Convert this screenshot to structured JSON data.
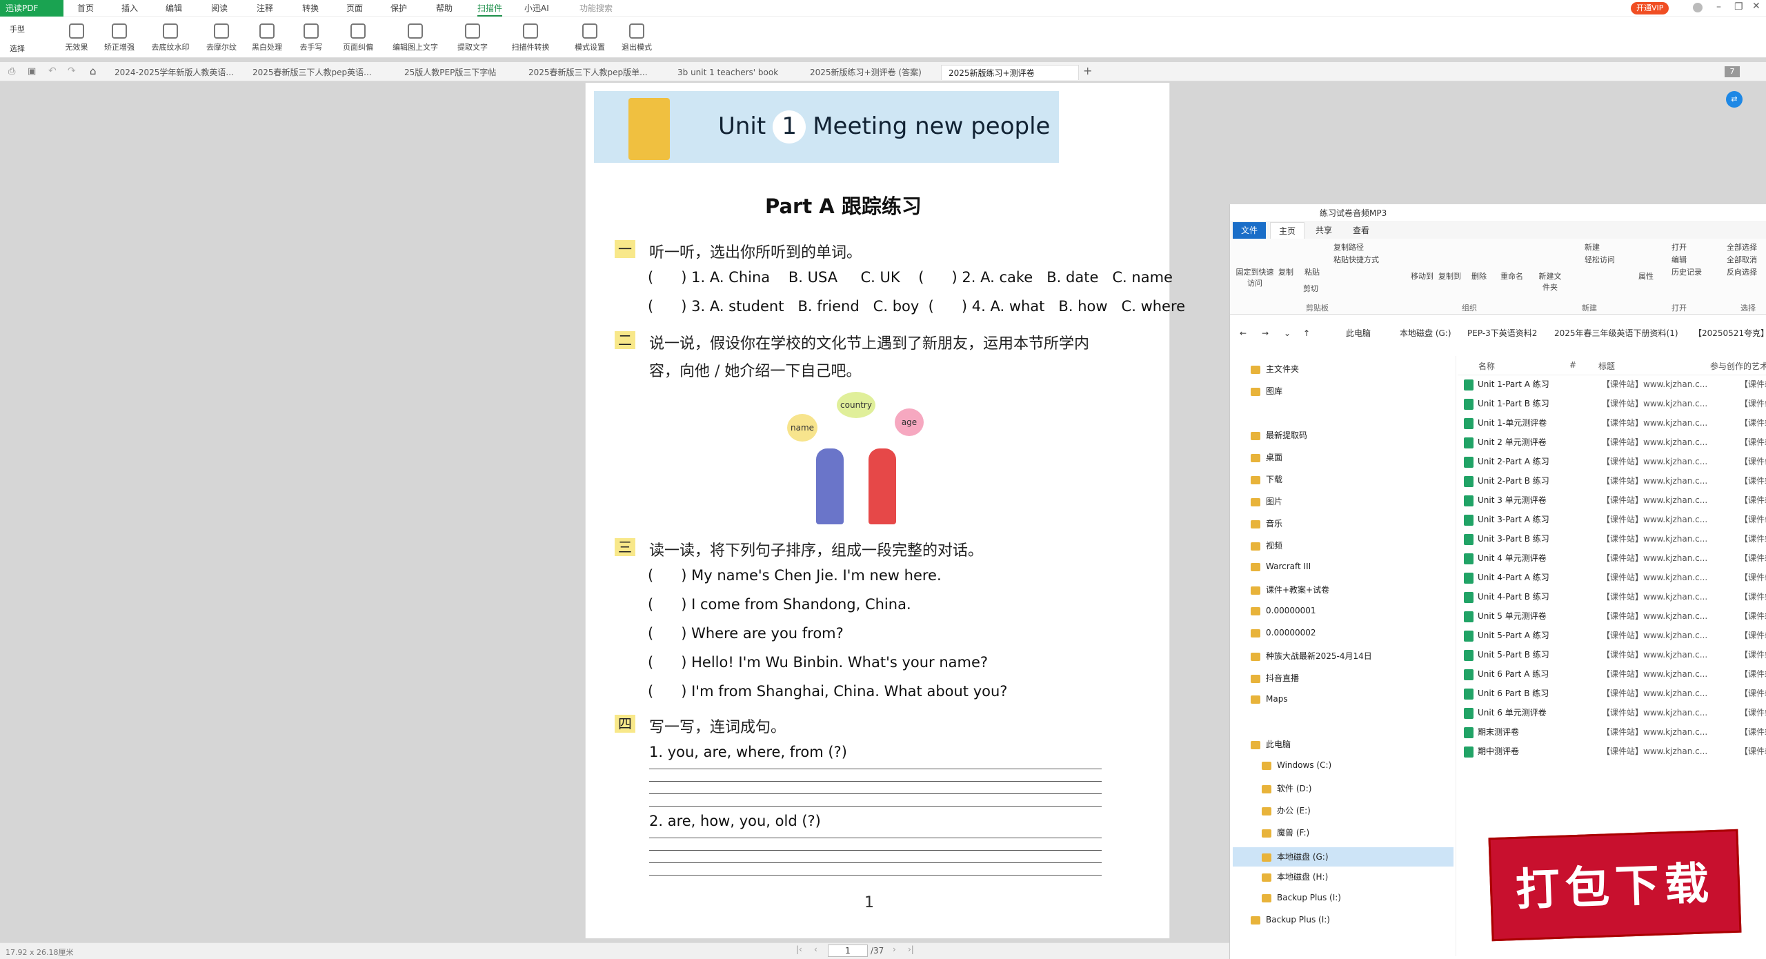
{
  "app": {
    "logo": "迅读PDF",
    "vip": "开通VIP",
    "menu": [
      "首页",
      "插入",
      "编辑",
      "阅读",
      "注释",
      "转换",
      "页面",
      "保护",
      "帮助",
      "扫描件",
      "小迅AI",
      "功能搜索"
    ],
    "active_menu": "扫描件",
    "left_tools": [
      "手型",
      "选择"
    ],
    "tools": [
      "无效果",
      "矫正增强",
      "去底纹水印",
      "去摩尔纹",
      "黑白处理",
      "去手写",
      "页面纠偏",
      "编辑图上文字",
      "提取文字",
      "扫描件转换",
      "模式设置",
      "退出模式"
    ],
    "tabs": [
      "2024-2025学年新版人教英语...",
      "2025春新版三下人教pep英语...",
      "25版人教PEP版三下字帖",
      "2025春新版三下人教pep版单...",
      "3b unit 1 teachers' book",
      "2025新版练习+测评卷 (答案)",
      "2025新版练习+测评卷"
    ],
    "tab_count": "7"
  },
  "pdf": {
    "unit_word": "Unit",
    "unit_num": "1",
    "unit_title": "Meeting new people",
    "part": "Part A 跟踪练习",
    "q1": {
      "num": "一",
      "text": "听一听，选出你所听到的单词。",
      "l1": "(      ) 1. A. China    B. USA     C. UK    (      ) 2. A. cake   B. date   C. name",
      "l2": "(      ) 3. A. student   B. friend   C. boy  (      ) 4. A. what   B. how   C. where"
    },
    "q2": {
      "num": "二",
      "text": "说一说，假设你在学校的文化节上遇到了新朋友，运用本节所学内",
      "text2": "容，向他 / 她介绍一下自己吧。",
      "bubbles": [
        "country",
        "name",
        "age"
      ]
    },
    "q3": {
      "num": "三",
      "text": "读一读，将下列句子排序，组成一段完整的对话。",
      "items": [
        "(      ) My name's Chen Jie. I'm new here.",
        "(      ) I come from Shandong, China.",
        "(      ) Where are you from?",
        "(      ) Hello! I'm Wu Binbin. What's your name?",
        "(      ) I'm from Shanghai, China. What about you?"
      ]
    },
    "q4": {
      "num": "四",
      "text": "写一写，连词成句。",
      "s1": "1. you, are, where, from (?)",
      "s2": "2. are, how, you, old (?)"
    },
    "page_number": "1"
  },
  "status": {
    "size": "17.92 x 26.18厘米",
    "page": "1",
    "total": "/37"
  },
  "explorer": {
    "title": "练习试卷音频MP3",
    "tabs": [
      "文件",
      "主页",
      "共享",
      "查看"
    ],
    "ribbon": [
      "固定到快速访问",
      "复制",
      "粘贴",
      "复制路径",
      "粘贴快捷方式",
      "剪切",
      "移动到",
      "复制到",
      "删除",
      "重命名",
      "新建文件夹",
      "新建",
      "轻松访问",
      "属性",
      "打开",
      "编辑",
      "历史记录",
      "全部选择",
      "全部取消",
      "反向选择"
    ],
    "groups": [
      "剪贴板",
      "组织",
      "新建",
      "打开",
      "选择"
    ],
    "address": [
      "此电脑",
      "本地磁盘 (G:)",
      "PEP-3下英语资料2",
      "2025年春三年级英语下册资料(1)",
      "【20250521夸克】"
    ],
    "headers": [
      "名称",
      "#",
      "标题",
      "参与创作的艺术"
    ],
    "nav": [
      "主文件夹",
      "图库",
      "最新提取码",
      "桌面",
      "下载",
      "图片",
      "音乐",
      "视频",
      "Warcraft III",
      "课件+教案+试卷",
      "0.00000001",
      "0.00000002",
      "种族大战最新2025-4月14日",
      "抖音直播",
      "Maps",
      "此电脑",
      "Windows (C:)",
      "软件 (D:)",
      "办公 (E:)",
      "魔兽 (F:)",
      "本地磁盘 (G:)",
      "本地磁盘 (H:)",
      "Backup Plus (I:)",
      "Backup Plus (I:)"
    ],
    "files": [
      "Unit 1-Part A 练习",
      "Unit 1-Part B 练习",
      "Unit 1-单元测评卷",
      "Unit 2 单元测评卷",
      "Unit 2-Part A 练习",
      "Unit 2-Part B 练习",
      "Unit 3 单元测评卷",
      "Unit 3-Part A 练习",
      "Unit 3-Part B 练习",
      "Unit 4 单元测评卷",
      "Unit 4-Part A 练习",
      "Unit 4-Part B 练习",
      "Unit 5 单元测评卷",
      "Unit 5-Part A 练习",
      "Unit 5-Part B 练习",
      "Unit 6 Part A 练习",
      "Unit 6 Part B 练习",
      "Unit 6 单元测评卷",
      "期末测评卷",
      "期中测评卷"
    ],
    "title_col": "【课件站】www.kjzhan.c...",
    "artist_col": "【课件站】ww"
  },
  "stamp": "打包下载"
}
